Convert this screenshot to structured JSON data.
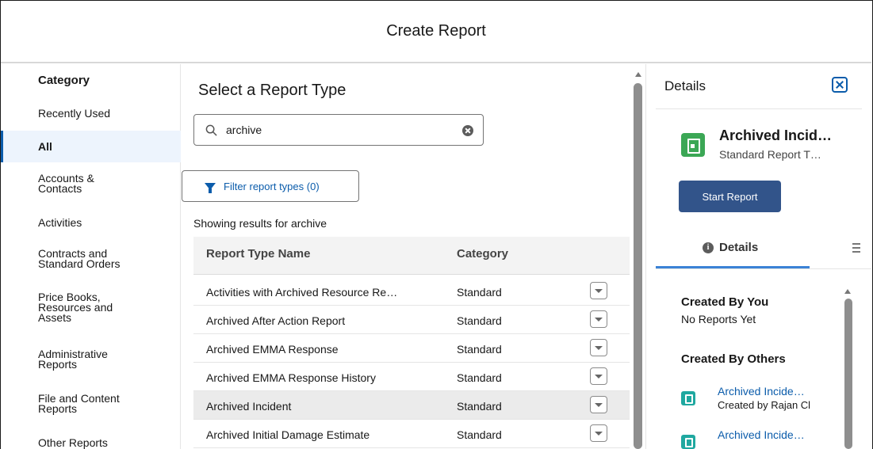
{
  "header": {
    "title": "Create Report"
  },
  "sidebar": {
    "title": "Category",
    "items": [
      {
        "label": "Recently Used"
      },
      {
        "label": "All"
      },
      {
        "label": "Accounts & Contacts"
      },
      {
        "label": "Activities"
      },
      {
        "label": "Contracts and Standard Orders"
      },
      {
        "label": "Price Books, Resources and Assets"
      },
      {
        "label": "Administrative Reports"
      },
      {
        "label": "File and Content Reports"
      },
      {
        "label": "Other Reports"
      }
    ]
  },
  "main": {
    "title": "Select a Report Type",
    "search": {
      "value": "archive",
      "placeholder": ""
    },
    "filter_label": "Filter report types (0)",
    "showing_text": "Showing results for archive",
    "columns": [
      "Report Type Name",
      "Category"
    ],
    "rows": [
      {
        "name": "Activities with Archived Resource Re…",
        "category": "Standard"
      },
      {
        "name": "Archived After Action Report",
        "category": "Standard"
      },
      {
        "name": "Archived EMMA Response",
        "category": "Standard"
      },
      {
        "name": "Archived EMMA Response History",
        "category": "Standard"
      },
      {
        "name": "Archived Incident",
        "category": "Standard"
      },
      {
        "name": "Archived Initial Damage Estimate",
        "category": "Standard"
      }
    ]
  },
  "details": {
    "title": "Details",
    "report_name": "Archived Incid…",
    "report_sub": "Standard Report T…",
    "start_label": "Start Report",
    "tab_label": "Details",
    "created_by_you": "Created By You",
    "no_reports": "No Reports Yet",
    "created_by_others": "Created By Others",
    "others": [
      {
        "name": "Archived Incide…",
        "by": "Created by Rajan Cl"
      },
      {
        "name": "Archived Incide…",
        "by": ""
      }
    ]
  },
  "colors": {
    "accent": "#0b5cab",
    "button": "#32548a",
    "report_icon": "#3ba755",
    "list_icon": "#1fa8a0"
  }
}
